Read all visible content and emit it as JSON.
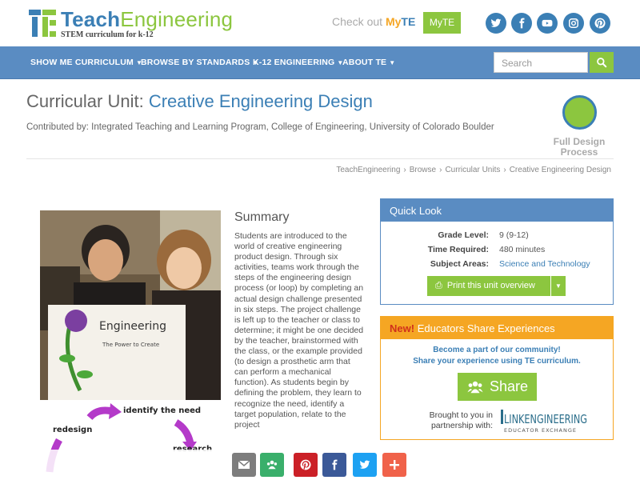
{
  "header": {
    "logo_teach": "Teach",
    "logo_engineering": "Engineering",
    "tagline": "STEM curriculum for k-12",
    "checkout_prefix": "Check out",
    "checkout_my": "My",
    "checkout_te": "TE",
    "myte_button": "MyTE",
    "social_icons": [
      "twitter-icon",
      "facebook-icon",
      "youtube-icon",
      "instagram-icon",
      "pinterest-icon"
    ]
  },
  "nav": {
    "items": [
      {
        "label": "SHOW ME CURRICULUM"
      },
      {
        "label": "BROWSE BY STANDARDS"
      },
      {
        "label": "K-12 ENGINEERING"
      },
      {
        "label": "ABOUT TE"
      }
    ],
    "search_placeholder": "Search"
  },
  "page": {
    "title_prefix": "Curricular Unit:",
    "title_name": "Creative Engineering Design",
    "contributed": "Contributed by: Integrated Teaching and Learning Program, College of Engineering, University of Colorado Boulder",
    "design_label": "Full Design Process",
    "breadcrumb": [
      "TeachEngineering",
      "Browse",
      "Curricular Units",
      "Creative Engineering Design"
    ]
  },
  "images": {
    "poster_text": "Engineering",
    "poster_sub": "The Power to Create",
    "cycle_labels": [
      "identify the need",
      "redesign",
      "research"
    ]
  },
  "summary": {
    "heading": "Summary",
    "text": "Students are introduced to the world of creative engineering product design. Through six activities, teams work through the steps of the engineering design process (or loop) by completing an actual design challenge presented in six steps. The project challenge is left up to the teacher or class to determine; it might be one decided by the teacher, brainstormed with the class, or the example provided (to design a prosthetic arm that can perform a mechanical function). As students begin by defining the problem, they learn to recognize the need, identify a target population, relate to the project"
  },
  "quick_look": {
    "heading": "Quick Look",
    "grade_label": "Grade Level:",
    "grade_value": "9 (9-12)",
    "time_label": "Time Required:",
    "time_value": "480 minutes",
    "subject_label": "Subject Areas:",
    "subject_value": "Science and Technology",
    "print_button": "Print this unit overview"
  },
  "educators": {
    "new_label": "New!",
    "heading": "Educators Share Experiences",
    "line1": "Become a part of our community!",
    "line2": "Share your experience using TE curriculum.",
    "share_button": "Share",
    "brought_by": "Brought to you in partnership with:",
    "partner_logo_main": "LINKENGINEERING",
    "partner_logo_sub": "EDUCATOR EXCHANGE"
  },
  "share_bar": {
    "buttons": [
      {
        "icon": "email-icon",
        "color": "#7d7d7d"
      },
      {
        "icon": "share-icon",
        "color": "#3aaf6b"
      },
      {
        "icon": "pinterest-icon",
        "color": "#cb2027"
      },
      {
        "icon": "facebook-icon",
        "color": "#3b5998"
      },
      {
        "icon": "twitter-icon",
        "color": "#1da1f2"
      },
      {
        "icon": "plus-icon",
        "color": "#f0624a"
      }
    ]
  },
  "colors": {
    "brand_blue": "#3b7fb5",
    "brand_green": "#8cc63f",
    "nav_blue": "#5a8cc2",
    "orange": "#f5a623"
  }
}
